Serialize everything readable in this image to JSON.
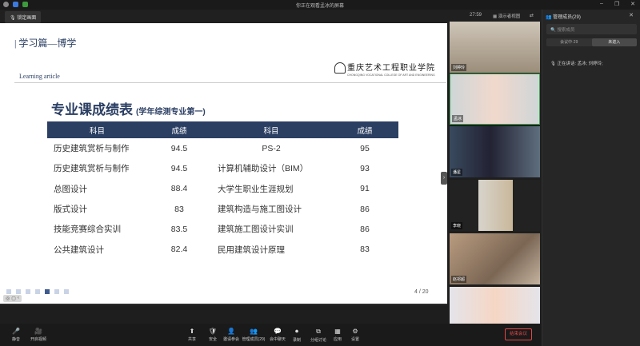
{
  "window": {
    "title": "你正在观看孟冰的屏幕"
  },
  "topbar": {
    "speaker_badge": "锁定画面",
    "time": "27:59",
    "view_label": "演示者视图",
    "toggle": "⇄"
  },
  "slide": {
    "header_title": "| 学习篇—博学",
    "header_subtitle": "Learning article",
    "school_cn": "重庆艺术工程职业学院",
    "school_en": "CHONGQING VOCATIONAL COLLEGE OF ART AND ENGINEERING",
    "title": "专业课成绩表",
    "title_note": "(学年综测专业第一)",
    "columns": [
      "科目",
      "成绩",
      "科目",
      "成绩"
    ],
    "rows": [
      [
        "历史建筑赏析与制作",
        "94.5",
        "PS-2",
        "95"
      ],
      [
        "历史建筑赏析与制作",
        "94.5",
        "计算机辅助设计（BIM）",
        "93"
      ],
      [
        "总图设计",
        "88.4",
        "大学生职业生涯规划",
        "91"
      ],
      [
        "版式设计",
        "83",
        "建筑构造与施工图设计",
        "86"
      ],
      [
        "技能竞赛综合实训",
        "83.5",
        "建筑施工图设计实训",
        "86"
      ],
      [
        "公共建筑设计",
        "82.4",
        "民用建筑设计原理",
        "83"
      ]
    ],
    "page": "4 / 20",
    "tools": [
      "◎",
      "▢",
      "‹"
    ]
  },
  "gallery": [
    "刘婷玲",
    "孟冰",
    "潘星",
    "李晓",
    "赵祁超",
    ""
  ],
  "panel": {
    "title": "管理成员(29)",
    "close": "✕",
    "search_placeholder": "搜索成员",
    "tabs": [
      "会议中·29",
      "未进入"
    ],
    "member_line": "正在讲话: 孟冰; 刘婷玲;"
  },
  "bottombar": {
    "buttons": [
      {
        "icon": "🎤",
        "label": "静音"
      },
      {
        "icon": "🎥",
        "label": "开启视频"
      },
      {
        "icon": "⬆",
        "label": "共享"
      },
      {
        "icon": "🛡",
        "label": "安全"
      },
      {
        "icon": "👤",
        "label": "邀请参会"
      },
      {
        "icon": "👥",
        "label": "管理成员(29)"
      },
      {
        "icon": "💬",
        "label": "会中聊天"
      },
      {
        "icon": "⏺",
        "label": "录制"
      },
      {
        "icon": "⧉",
        "label": "分组讨论"
      },
      {
        "icon": "▦",
        "label": "应用"
      },
      {
        "icon": "⚙",
        "label": "设置"
      }
    ],
    "leave": "结束会议"
  },
  "colors": {
    "accent": "#2b3f63",
    "leave": "#e04848"
  }
}
